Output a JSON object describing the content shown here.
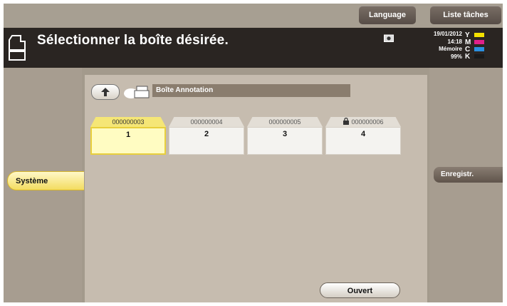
{
  "top_buttons": {
    "language": "Language",
    "task_list": "Liste tâches"
  },
  "header": {
    "title": "Sélectionner la boîte désirée.",
    "date": "19/01/2012",
    "time": "14:18",
    "memory_label": "Mémoire",
    "memory_value": "99%"
  },
  "toner": [
    {
      "letter": "Y",
      "color": "#f4e000"
    },
    {
      "letter": "M",
      "color": "#e0208a"
    },
    {
      "letter": "C",
      "color": "#2a90e0"
    },
    {
      "letter": "K",
      "color": "#1a1a1a"
    }
  ],
  "path": {
    "label": "Boîte Annotation"
  },
  "boxes": [
    {
      "id": "000000003",
      "num": "1",
      "selected": true,
      "locked": false
    },
    {
      "id": "000000004",
      "num": "2",
      "selected": false,
      "locked": false
    },
    {
      "id": "000000005",
      "num": "3",
      "selected": false,
      "locked": false
    },
    {
      "id": "000000006",
      "num": "4",
      "selected": false,
      "locked": true
    }
  ],
  "left_tab": {
    "label": "Système"
  },
  "right_menu": {
    "label": "Enregistr."
  },
  "actions": {
    "open_label": "Ouvert"
  }
}
